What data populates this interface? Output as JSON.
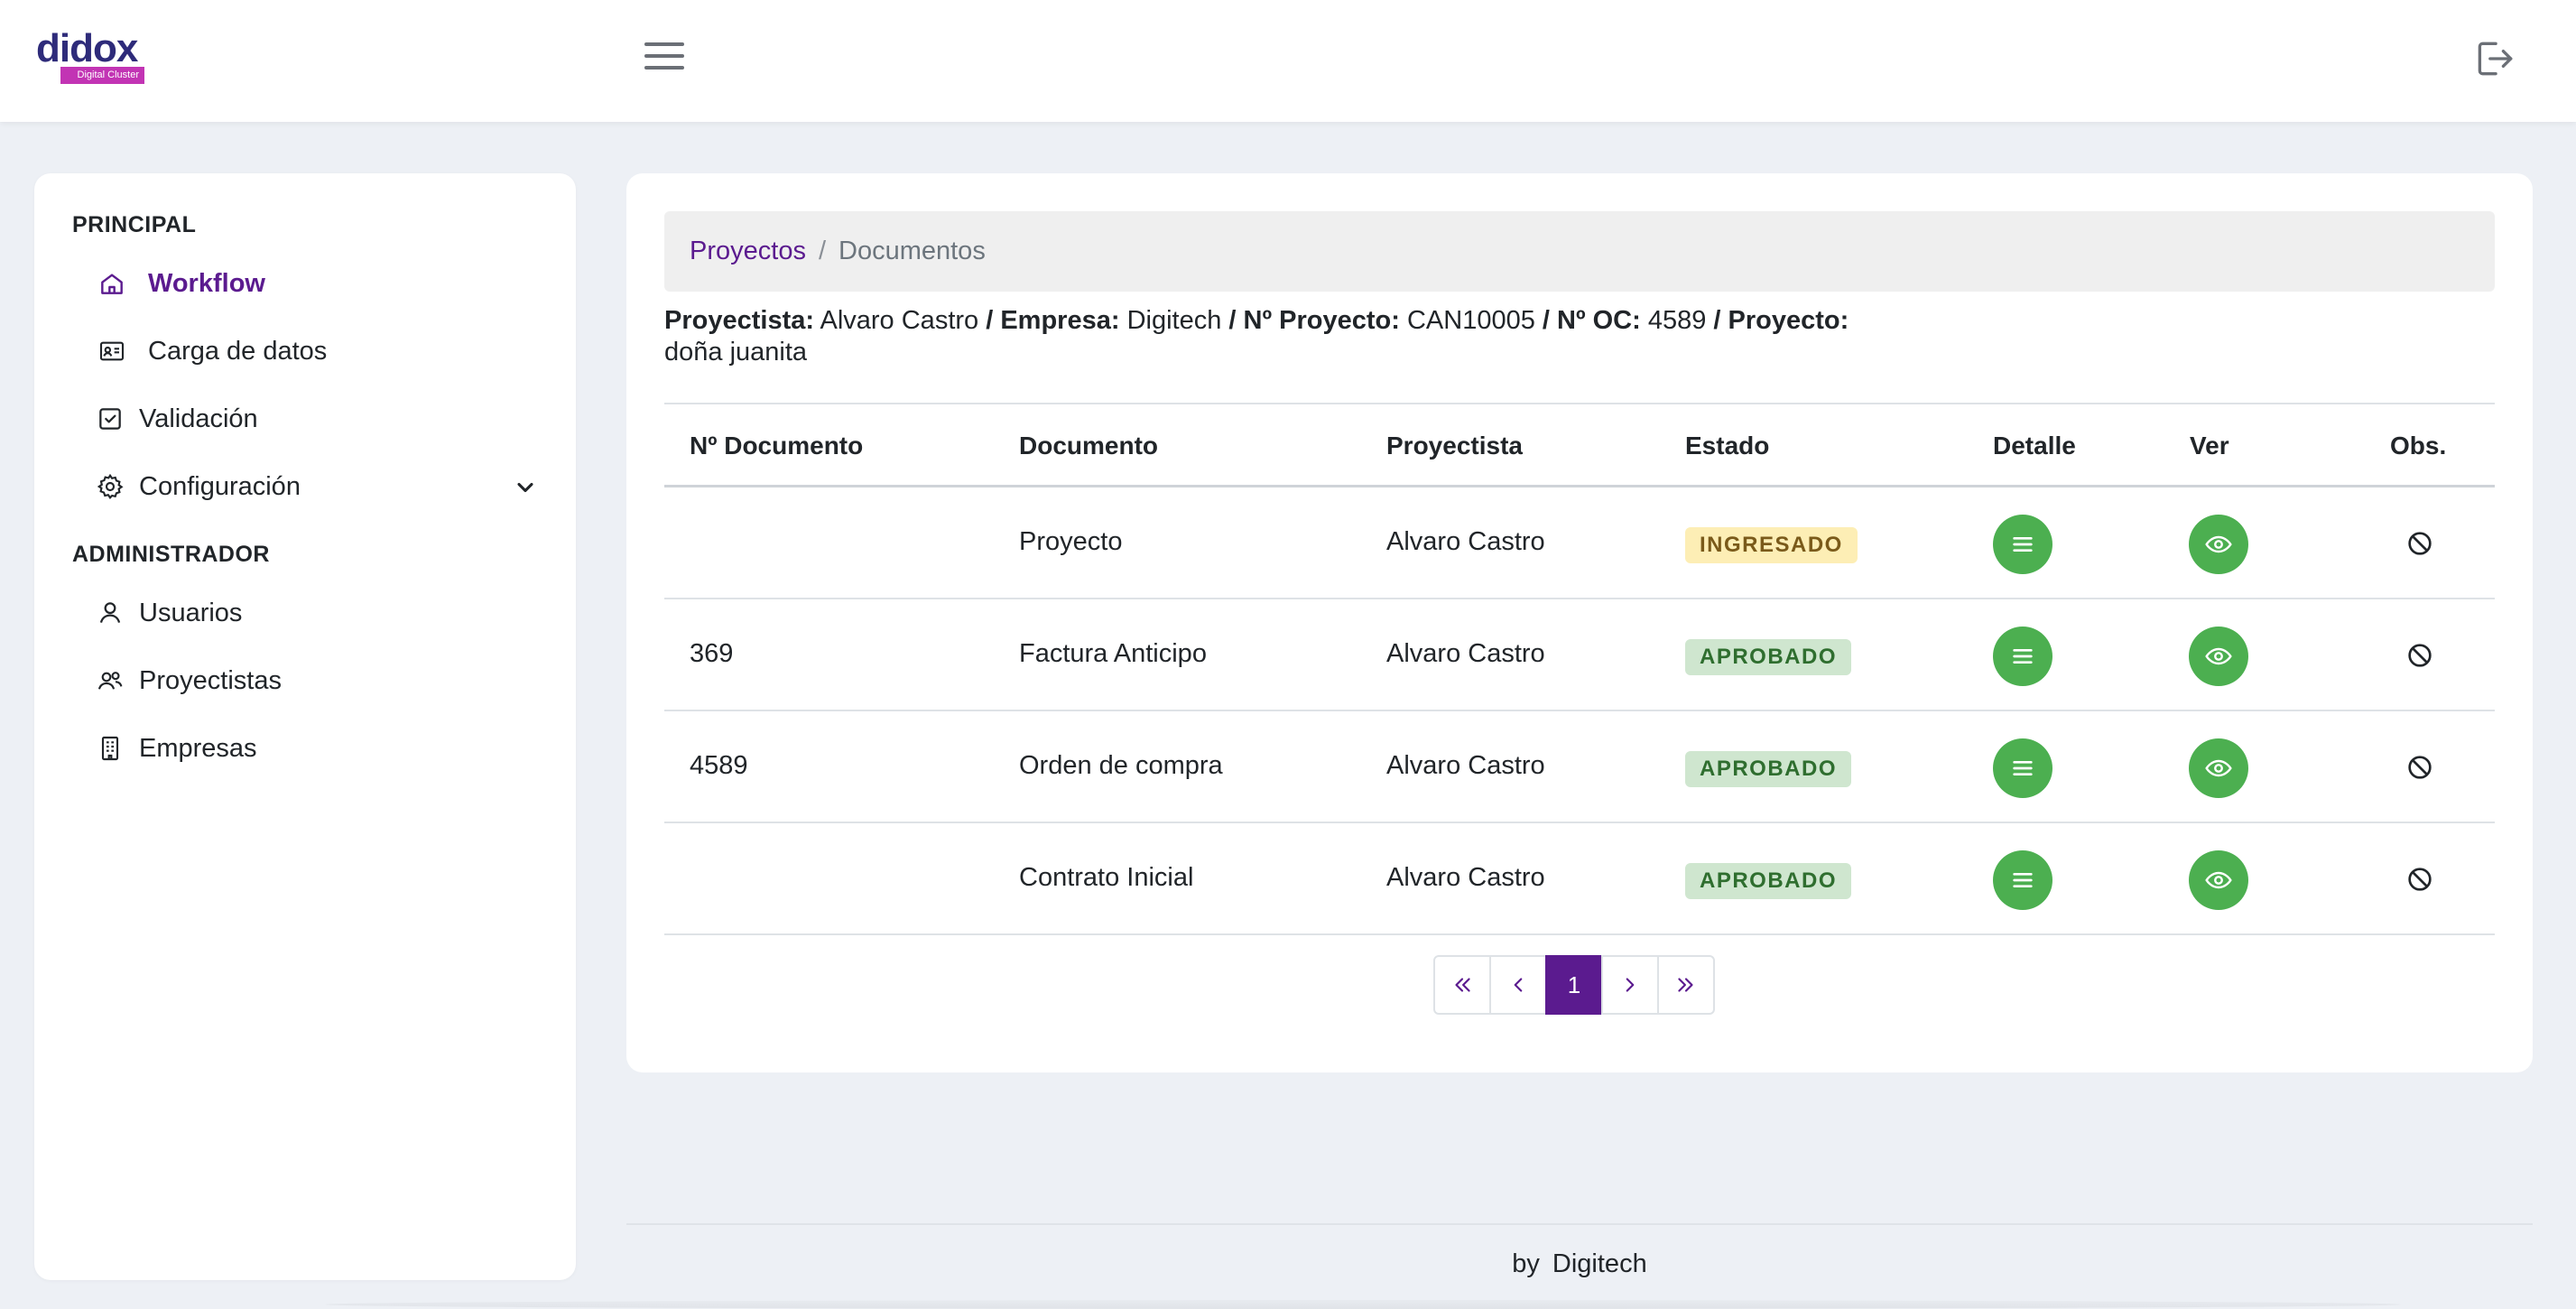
{
  "app": {
    "logo_text": "didox",
    "logo_tagline": "Digital Cluster"
  },
  "sidebar": {
    "sections": [
      {
        "title": "PRINCIPAL",
        "items": [
          {
            "label": "Workflow",
            "icon": "home-icon",
            "active": true
          },
          {
            "label": "Carga de datos",
            "icon": "id-card-icon"
          },
          {
            "label": "Validación",
            "icon": "check-square-icon"
          },
          {
            "label": "Configuración",
            "icon": "gear-icon",
            "expandable": true
          }
        ]
      },
      {
        "title": "ADMINISTRADOR",
        "items": [
          {
            "label": "Usuarios",
            "icon": "user-icon"
          },
          {
            "label": "Proyectistas",
            "icon": "users-icon"
          },
          {
            "label": "Empresas",
            "icon": "building-icon"
          }
        ]
      }
    ]
  },
  "breadcrumb": {
    "link": "Proyectos",
    "separator": "/",
    "current": "Documentos"
  },
  "info": {
    "proyectista_label": "Proyectista:",
    "proyectista": "Alvaro Castro",
    "empresa_label": "Empresa:",
    "empresa": "Digitech",
    "nproyecto_label": "Nº Proyecto:",
    "nproyecto": "CAN10005",
    "noc_label": "Nº OC:",
    "noc": "4589",
    "proyecto_label": "Proyecto:",
    "proyecto": "doña juanita",
    "sep": "/"
  },
  "table": {
    "headers": [
      "Nº Documento",
      "Documento",
      "Proyectista",
      "Estado",
      "Detalle",
      "Ver",
      "Obs."
    ],
    "rows": [
      {
        "numero": "",
        "documento": "Proyecto",
        "proyectista": "Alvaro Castro",
        "estado": "INGRESADO"
      },
      {
        "numero": "369",
        "documento": "Factura Anticipo",
        "proyectista": "Alvaro Castro",
        "estado": "APROBADO"
      },
      {
        "numero": "4589",
        "documento": "Orden de compra",
        "proyectista": "Alvaro Castro",
        "estado": "APROBADO"
      },
      {
        "numero": "",
        "documento": "Contrato Inicial",
        "proyectista": "Alvaro Castro",
        "estado": "APROBADO"
      }
    ]
  },
  "pagination": {
    "current_page": "1"
  },
  "footer": {
    "by": "by",
    "company": "Digitech"
  },
  "colors": {
    "brand_purple": "#5b1b8f",
    "action_green": "#4caf50",
    "badge_ingresado_bg": "#fdeeb5",
    "badge_aprobado_bg": "#cfe6cf"
  }
}
